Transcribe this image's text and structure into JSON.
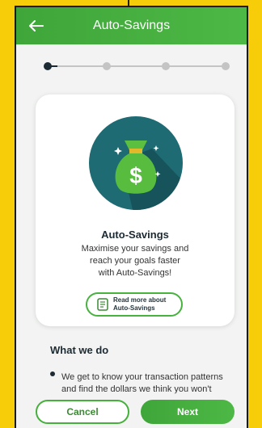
{
  "header": {
    "title": "Auto-Savings",
    "back_icon": "arrow-left-icon"
  },
  "stepper": {
    "total_steps": 4,
    "current_step": 1,
    "active_color": "#1c2a33",
    "inactive_color": "#bdbdbd"
  },
  "card": {
    "illustration_icon": "money-bag-dollar-icon",
    "title": "Auto-Savings",
    "description": "Maximise your savings and\nreach your goals faster\nwith Auto-Savings!",
    "read_more": {
      "label": "Read more about\nAuto-Savings",
      "icon": "document-icon"
    }
  },
  "section": {
    "heading": "What we do",
    "bullets": [
      "We get to know your transaction patterns and find the dollars we think you won't"
    ]
  },
  "actions": {
    "cancel_label": "Cancel",
    "next_label": "Next"
  },
  "colors": {
    "brand_green": "#45b03c",
    "background_yellow": "#f7cd0a",
    "illustration_teal": "#1f6b73"
  }
}
